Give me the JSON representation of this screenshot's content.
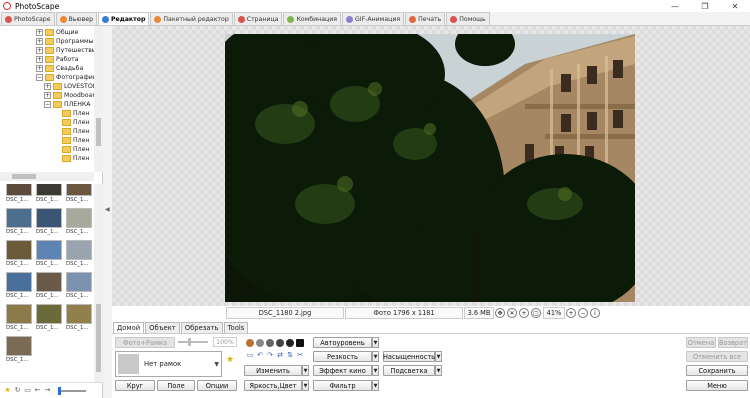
{
  "window": {
    "title": "PhotoScape",
    "controls": [
      "—",
      "❐",
      "✕"
    ]
  },
  "tabs": [
    {
      "label": "PhotoScape",
      "color": "#d9534f"
    },
    {
      "label": "Вьювер",
      "color": "#e9893a"
    },
    {
      "label": "Редактор",
      "color": "#3c7bd6",
      "active": true
    },
    {
      "label": "Пакетный редактор",
      "color": "#e9893a"
    },
    {
      "label": "Страница",
      "color": "#d9534f"
    },
    {
      "label": "Комбинация",
      "color": "#7fb74d"
    },
    {
      "label": "GIF-Анимация",
      "color": "#8a7fd1"
    },
    {
      "label": "Печать",
      "color": "#e06a3a"
    },
    {
      "label": "Помощь",
      "color": "#d9534f"
    }
  ],
  "tree": [
    {
      "label": "Общие",
      "exp": "+"
    },
    {
      "label": "Программы",
      "exp": "+"
    },
    {
      "label": "Путешествия",
      "exp": "+"
    },
    {
      "label": "Работа",
      "exp": "+"
    },
    {
      "label": "Свадьба",
      "exp": "+"
    },
    {
      "label": "Фотографии",
      "exp": "−"
    },
    {
      "label": "LOVESTORY",
      "exp": "+"
    },
    {
      "label": "Moodboard",
      "exp": "+"
    },
    {
      "label": "ПЛЕНКА",
      "exp": "−"
    },
    {
      "label": "Плен",
      "exp": ""
    },
    {
      "label": "Плен",
      "exp": ""
    },
    {
      "label": "Плен",
      "exp": ""
    },
    {
      "label": "Плен",
      "exp": ""
    },
    {
      "label": "Плен",
      "exp": ""
    },
    {
      "label": "Плен",
      "exp": ""
    }
  ],
  "thumbnails": [
    {
      "label": "DSC_1...",
      "color": "#5c4a3a"
    },
    {
      "label": "DSC_1...",
      "color": "#3d3a34"
    },
    {
      "label": "DSC_1...",
      "color": "#6a5840"
    },
    {
      "label": "DSC_1...",
      "color": "#4d6e8c"
    },
    {
      "label": "DSC_1...",
      "color": "#3b5675"
    },
    {
      "label": "DSC_1...",
      "color": "#a8a89c"
    },
    {
      "label": "DSC_1...",
      "color": "#6c5b3b"
    },
    {
      "label": "DSC_1...",
      "color": "#5d84b3"
    },
    {
      "label": "DSC_1...",
      "color": "#9aa4b0"
    },
    {
      "label": "DSC_1...",
      "color": "#4a6f9a"
    },
    {
      "label": "DSC_1...",
      "color": "#6a5a48"
    },
    {
      "label": "DSC_1...",
      "color": "#7d92b0"
    },
    {
      "label": "DSC_1...",
      "color": "#8d7a4a"
    },
    {
      "label": "DSC_1...",
      "color": "#6b6a3a"
    },
    {
      "label": "DSC_1...",
      "color": "#90804e"
    },
    {
      "label": "DSC_1...",
      "color": "#7a6b54"
    }
  ],
  "status": {
    "filename": "DSC_1180 2.jpg",
    "dimensions": "Фото 1796 x 1181",
    "filesize": "3.6 MB",
    "zoom": "41%"
  },
  "editor_tabs": [
    "Домой",
    "Объект",
    "Обрезать",
    "Tools"
  ],
  "editor": {
    "photo_frame_btn": "Фото+Рамка",
    "opacity": "100%",
    "frame_name": "Нет рамок",
    "btn_round": "Круг",
    "btn_field": "Поле",
    "btn_options": "Опции",
    "btn_autolevel": "Автоуровень",
    "btn_sharpness": "Резкость",
    "btn_resize": "Изменить",
    "btn_film": "Эффект кино",
    "btn_brightness": "Яркость,Цвет",
    "btn_filter": "Фильтр",
    "btn_saturation": "Насыщенность",
    "btn_backlight": "Подсветка",
    "btn_undo": "Отмена",
    "btn_redo": "Возврат",
    "btn_undo_all": "Отменить все",
    "btn_save": "Сохранить",
    "btn_menu": "Меню"
  }
}
